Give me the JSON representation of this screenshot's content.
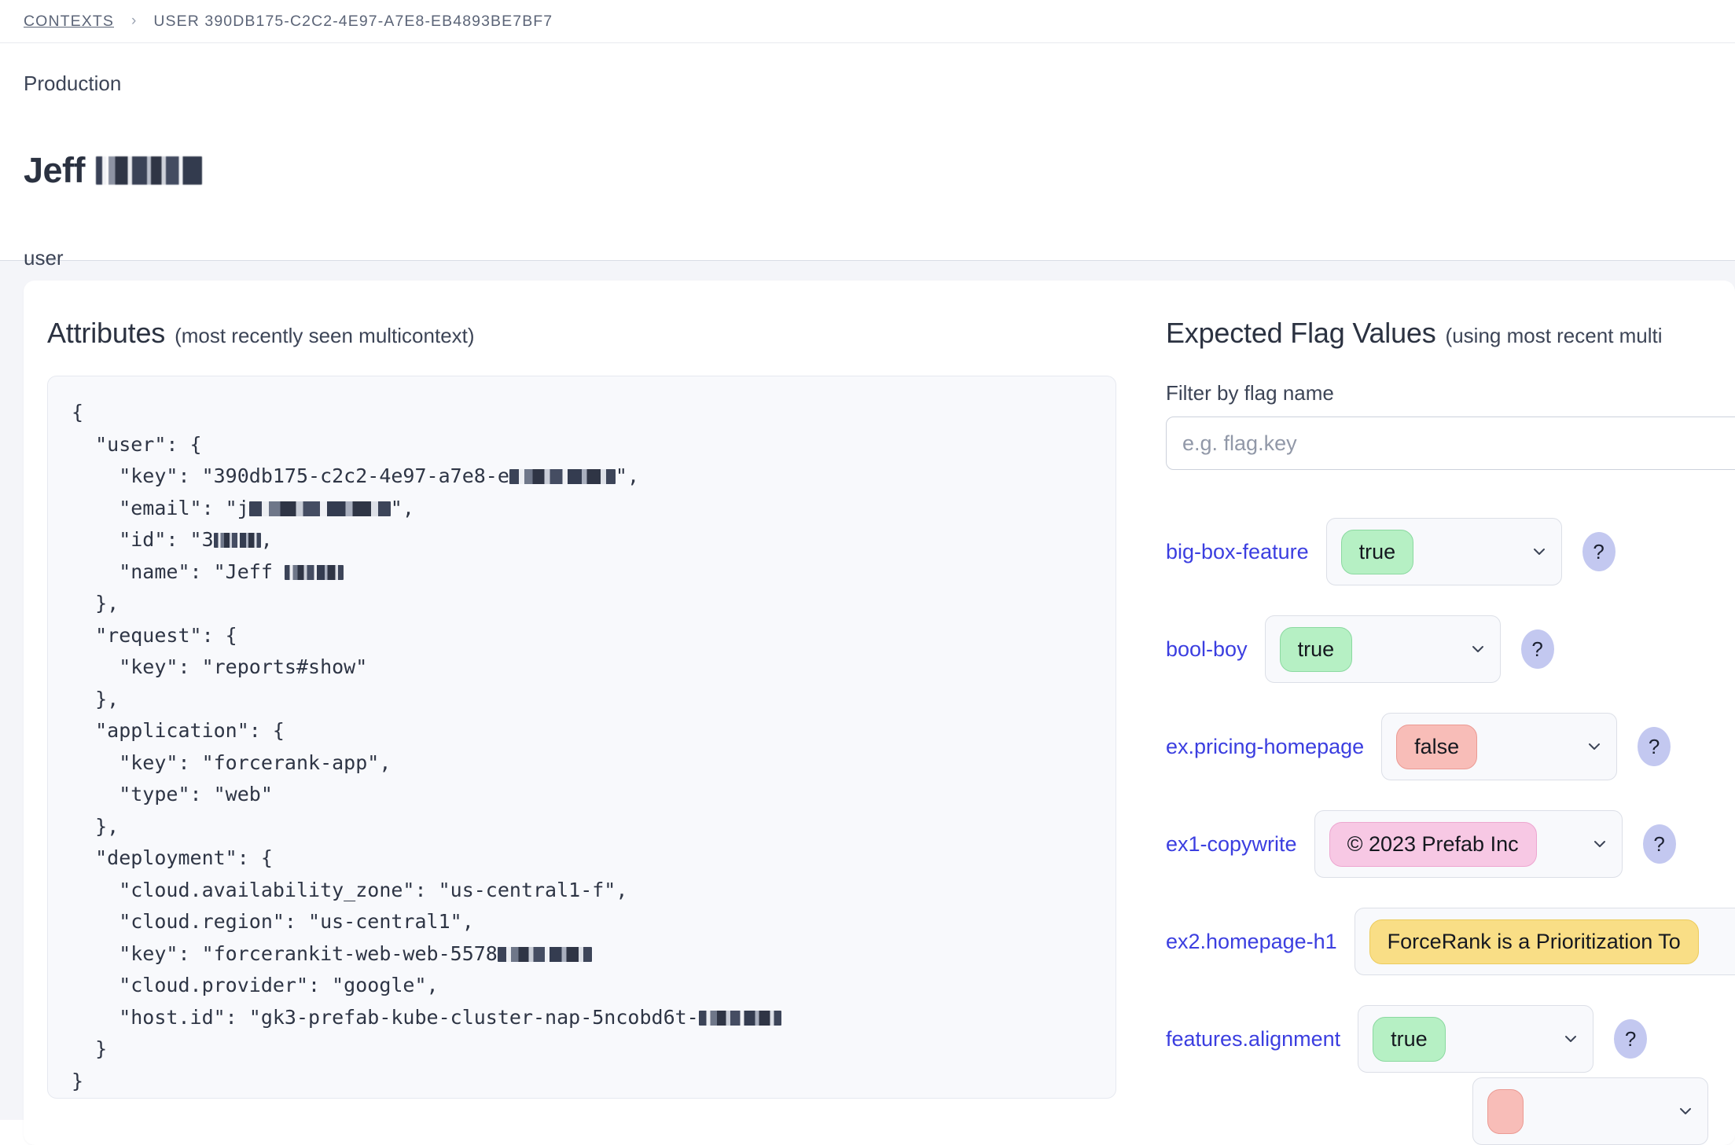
{
  "breadcrumb": {
    "root": "CONTEXTS",
    "separator": "›",
    "current": "USER 390DB175-C2C2-4E97-A7E8-EB4893BE7BF7"
  },
  "header": {
    "environment": "Production",
    "title": "Jeff",
    "title_redacted": true,
    "context_kind": "user"
  },
  "attributes_panel": {
    "title": "Attributes",
    "subtitle": "(most recently seen multicontext)",
    "json_lines": [
      "{",
      "  \"user\": {",
      "    \"key\": \"390db175-c2c2-4e97-a7e8-e█████████\",",
      "    \"email\": \"j████████████\",",
      "    \"id\": \"3████,",
      "    \"name\": \"Jeff █████",
      "  },",
      "  \"request\": {",
      "    \"key\": \"reports#show\"",
      "  },",
      "  \"application\": {",
      "    \"key\": \"forcerank-app\",",
      "    \"type\": \"web\"",
      "  },",
      "  \"deployment\": {",
      "    \"cloud.availability_zone\": \"us-central1-f\",",
      "    \"cloud.region\": \"us-central1\",",
      "    \"key\": \"forcerankit-web-web-5578████████",
      "    \"cloud.provider\": \"google\",",
      "    \"host.id\": \"gk3-prefab-kube-cluster-nap-5ncobd6t-███████",
      "  }",
      "}"
    ]
  },
  "flags_panel": {
    "title": "Expected Flag Values",
    "subtitle": "(using most recent multi",
    "filter_label": "Filter by flag name",
    "filter_value": "",
    "filter_placeholder": "e.g. flag.key",
    "help_glyph": "?",
    "rows": [
      {
        "name": "big-box-feature",
        "value": "true",
        "type": "bool-true",
        "select_width": 300,
        "show_help": true
      },
      {
        "name": "bool-boy",
        "value": "true",
        "type": "bool-true",
        "select_width": 300,
        "show_help": true
      },
      {
        "name": "ex.pricing-homepage",
        "value": "false",
        "type": "bool-false",
        "select_width": 300,
        "show_help": true
      },
      {
        "name": "ex1-copywrite",
        "value": "© 2023 Prefab Inc",
        "type": "str-pink",
        "select_width": 392,
        "show_help": true
      },
      {
        "name": "ex2.homepage-h1",
        "value": "ForceRank is a Prioritization To",
        "type": "str-yellow",
        "select_width": 560,
        "show_help": false
      },
      {
        "name": "features.alignment",
        "value": "true",
        "type": "bool-true",
        "select_width": 300,
        "show_help": true
      },
      {
        "name": "",
        "value": "",
        "type": "bool-false",
        "select_width": 300,
        "show_help": false
      }
    ]
  },
  "colors": {
    "link": "#3b3ee0",
    "true_pill": "#b6f0c4",
    "false_pill": "#f8bdb8",
    "string_pill_pink": "#f7c8e4",
    "string_pill_yellow": "#f9de86",
    "help_badge": "#c3c8f0",
    "page_bg": "#f4f5f9"
  }
}
